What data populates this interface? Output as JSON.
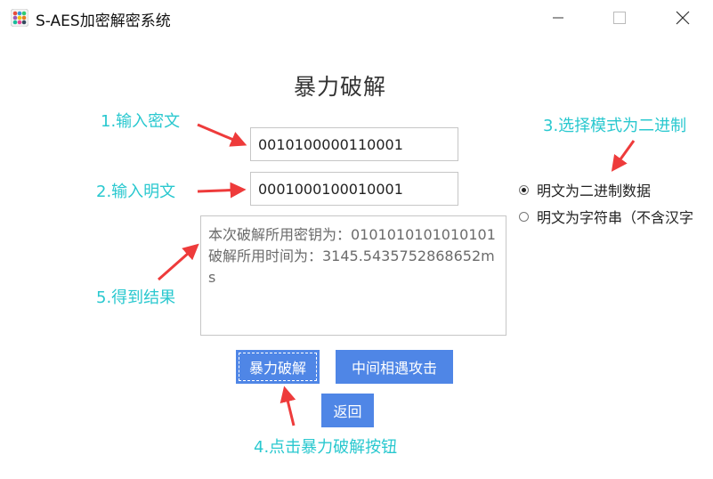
{
  "window": {
    "title": "S-AES加密解密系统",
    "controls": [
      "minimize-icon",
      "maximize-icon",
      "close-icon"
    ]
  },
  "main": {
    "heading": "暴力破解",
    "ciphertext_value": "0010100000110001",
    "plaintext_value": "0001000100010001",
    "result_text": "本次破解所用密钥为：0101010101010101\n破解所用时间为：3145.5435752868652ms"
  },
  "mode_options": [
    {
      "label": "明文为二进制数据",
      "selected": true
    },
    {
      "label": "明文为字符串（不含汉字",
      "selected": false
    }
  ],
  "buttons": {
    "brute_force": "暴力破解",
    "meet_in_middle": "中间相遇攻击",
    "back": "返回"
  },
  "annotations": {
    "step1": "1.输入密文",
    "step2": "2.输入明文",
    "step3": "3.选择模式为二进制",
    "step4": "4.点击暴力破解按钮",
    "step5": "5.得到结果"
  },
  "colors": {
    "annotation": "#29c8cf",
    "arrow": "#ee3b3b",
    "button": "#4f86e6"
  }
}
